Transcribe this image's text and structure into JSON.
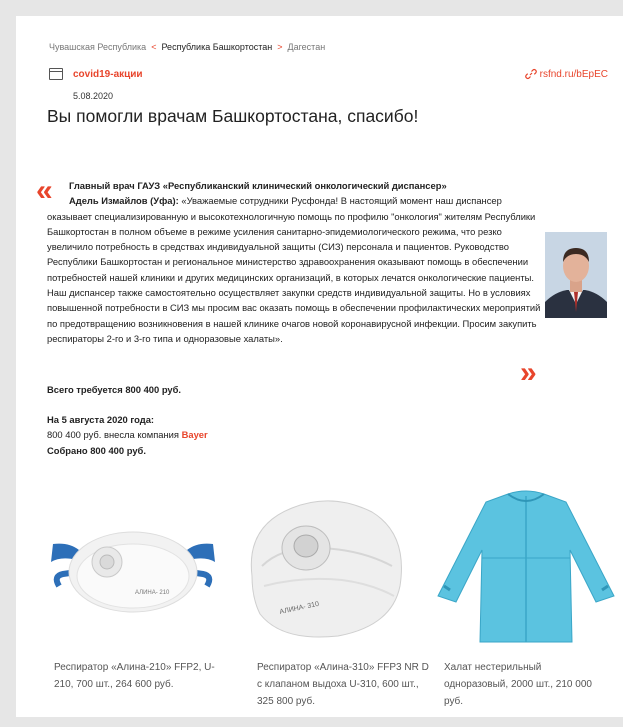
{
  "breadcrumb": {
    "prev": "Чувашская Республика",
    "prev_arrow": "<",
    "current": "Республика Башкортостан",
    "next_arrow": ">",
    "next": "Дагестан"
  },
  "tag": {
    "label": "covid19-акции"
  },
  "shortlink": {
    "label": "rsfnd.ru/bEpEC"
  },
  "date": "5.08.2020",
  "title": "Вы помогли врачам Башкортостана, спасибо!",
  "quote": {
    "open_mark": "«",
    "close_mark": "»",
    "author_title": "Главный врач ГАУЗ «Республиканский клинический онкологический диспансер»",
    "author_name": "Адель Измайлов (Уфа):",
    "text": "«Уважаемые сотрудники Русфонда! В настоящий момент наш диспансер оказывает специализированную и высокотехнологичную помощь по профилю \"онкология\" жителям Республики Башкортостан в полном объеме в режиме усиления санитарно-эпидемиологического режима, что резко увеличило потребность в средствах индивидуальной защиты (СИЗ) персонала и пациентов. Руководство Республики Башкортостан и региональное министерство здравоохранения оказывают помощь в обеспечении потребностей нашей клиники и других медицинских организаций, в которых лечатся онкологические пациенты. Наш диспансер также самостоятельно осуществляет закупки средств индивидуальной защиты. Но в условиях повышенной потребности в СИЗ мы просим вас оказать помощь в обеспечении профилактических мероприятий по предотвращению возникновения в нашей клинике очагов новой коронавирусной инфекции. Просим закупить респираторы 2-го и 3-го типа и одноразовые халаты»."
  },
  "summary": {
    "total": "Всего требуется 800 400 руб.",
    "as_of": "На 5 августа 2020 года:",
    "donation_prefix": "800 400 руб. внесла компания",
    "donor": "Bayer",
    "collected": "Собрано 800 400 руб."
  },
  "products": [
    {
      "caption": "Респиратор «Алина-210» FFP2, U-210, 700 шт., 264 600 руб.",
      "print": "АЛИНА- 210"
    },
    {
      "caption": "Респиратор «Алина-310» FFP3 NR D с клапаном выдоха U-310, 600 шт., 325 800 руб.",
      "print": "АЛИНА- 310"
    },
    {
      "caption": "Халат нестерильный одноразовый, 2000 шт., 210 000 руб."
    }
  ],
  "colors": {
    "accent": "#e8452c",
    "background": "#e6e6e6",
    "gown": "#5bc3e0"
  },
  "icons": {
    "tag": "folder-icon",
    "shortlink": "link-icon"
  }
}
